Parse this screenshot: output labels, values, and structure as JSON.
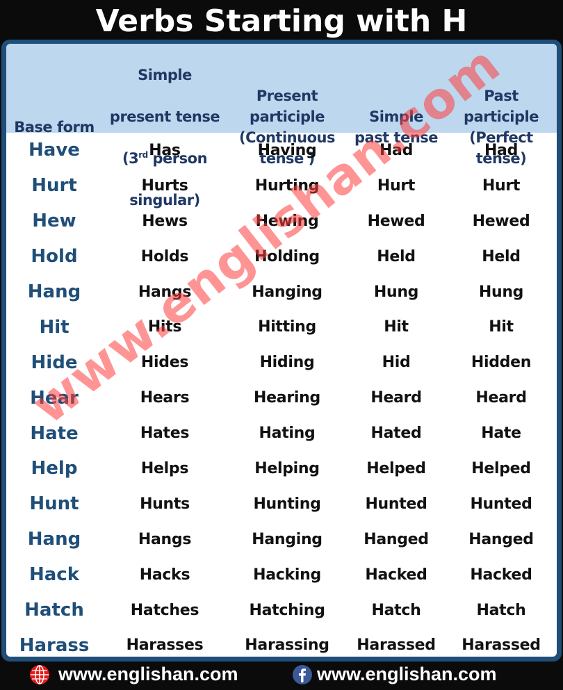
{
  "title": "Verbs Starting with H",
  "table": {
    "headers": [
      {
        "text": "Base form"
      },
      {
        "line1": "Simple",
        "line2": "present tense",
        "line3_pre": "(3",
        "line3_sup": "rd",
        "line3_post": " person",
        "line4": "singular)"
      },
      {
        "text": "Present\nparticiple\n(Continuous\ntense )"
      },
      {
        "text": "Simple\npast tense"
      },
      {
        "text": "Past\nparticiple\n(Perfect\ntense)"
      }
    ],
    "rows": [
      [
        "Have",
        "Has",
        "Having",
        "Had",
        "Had"
      ],
      [
        "Hurt",
        "Hurts",
        "Hurting",
        "Hurt",
        "Hurt"
      ],
      [
        "Hew",
        "Hews",
        "Hewing",
        "Hewed",
        "Hewed"
      ],
      [
        "Hold",
        "Holds",
        "Holding",
        "Held",
        "Held"
      ],
      [
        "Hang",
        "Hangs",
        "Hanging",
        "Hung",
        "Hung"
      ],
      [
        "Hit",
        "Hits",
        "Hitting",
        "Hit",
        "Hit"
      ],
      [
        "Hide",
        "Hides",
        "Hiding",
        "Hid",
        "Hidden"
      ],
      [
        "Hear",
        "Hears",
        "Hearing",
        "Heard",
        "Heard"
      ],
      [
        "Hate",
        "Hates",
        "Hating",
        "Hated",
        "Hate"
      ],
      [
        "Help",
        "Helps",
        "Helping",
        "Helped",
        "Helped"
      ],
      [
        "Hunt",
        "Hunts",
        "Hunting",
        "Hunted",
        "Hunted"
      ],
      [
        "Hang",
        "Hangs",
        "Hanging",
        "Hanged",
        "Hanged"
      ],
      [
        "Hack",
        "Hacks",
        "Hacking",
        "Hacked",
        "Hacked"
      ],
      [
        "Hatch",
        "Hatches",
        "Hatching",
        "Hatch",
        "Hatch"
      ],
      [
        "Harass",
        "Harasses",
        "Harassing",
        "Harassed",
        "Harassed"
      ]
    ]
  },
  "watermark": "www.englishan.com",
  "footer": {
    "website": {
      "icon": "globe-icon",
      "text": "www.englishan.com"
    },
    "facebook": {
      "icon": "facebook-icon",
      "text": "www.englishan.com"
    }
  },
  "colors": {
    "background": "#0b0b0b",
    "panel_border": "#1f4e79",
    "header_bg": "#bdd7ee",
    "header_text": "#1f3864",
    "base_form_text": "#1f4e79",
    "cell_text": "#111111",
    "watermark": "#ff3c3c",
    "globe_icon": "#e31b1b",
    "facebook_icon": "#3b5998"
  }
}
